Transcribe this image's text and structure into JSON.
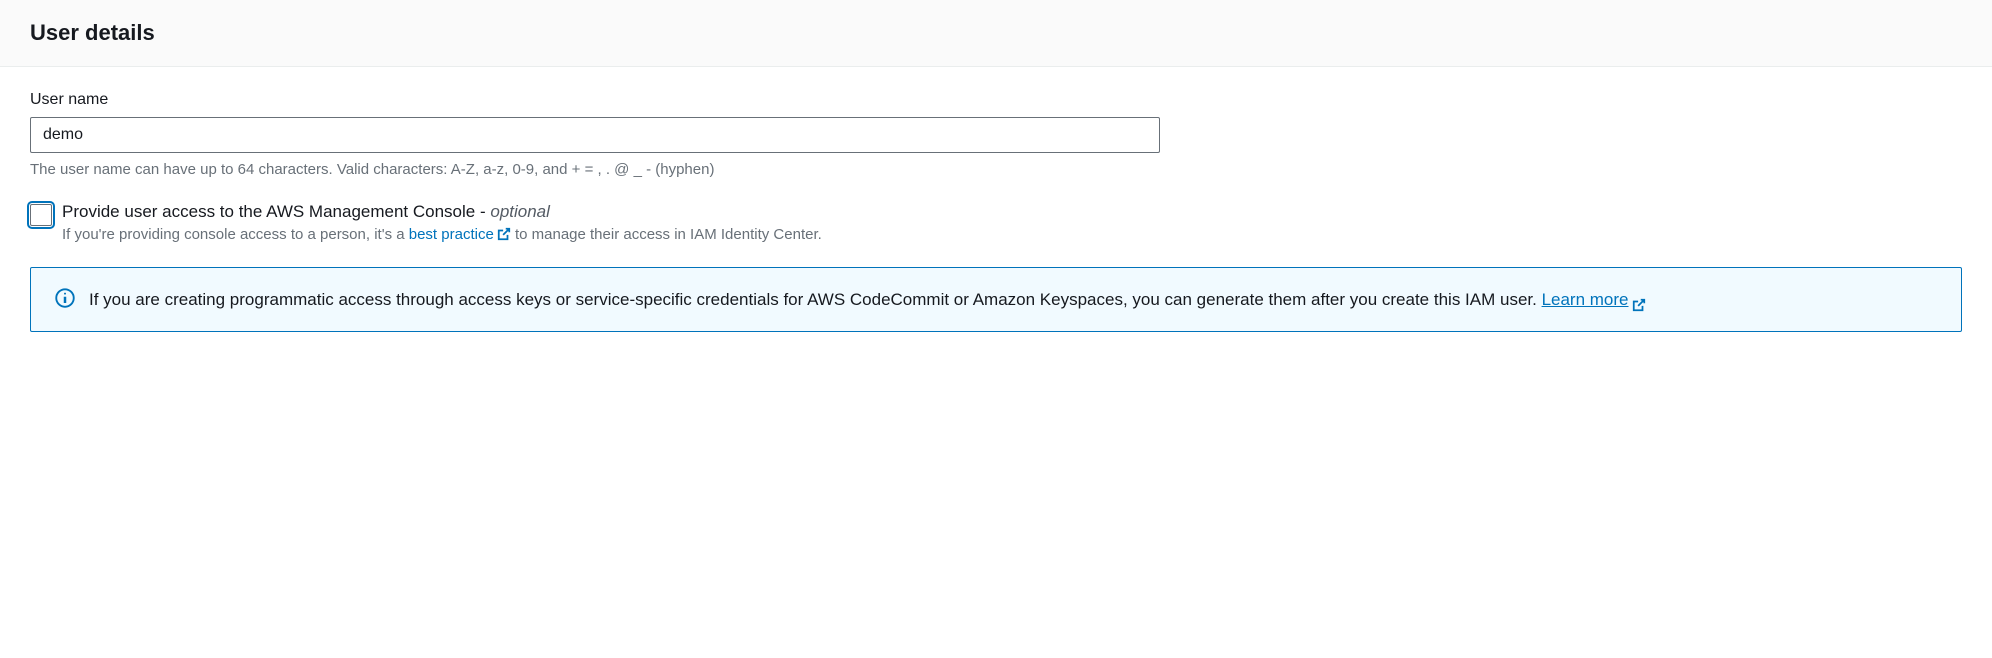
{
  "header": {
    "title": "User details"
  },
  "username": {
    "label": "User name",
    "value": "demo",
    "helper": "The user name can have up to 64 characters. Valid characters: A-Z, a-z, 0-9, and + = , . @ _ - (hyphen)"
  },
  "consoleAccess": {
    "label": "Provide user access to the AWS Management Console - ",
    "optional": "optional",
    "helperPrefix": "If you're providing console access to a person, it's a ",
    "bestPracticeLink": "best practice",
    "helperSuffix": " to manage their access in IAM Identity Center."
  },
  "infoBox": {
    "text": "If you are creating programmatic access through access keys or service-specific credentials for AWS CodeCommit or Amazon Keyspaces, you can generate them after you create this IAM user. ",
    "learnMore": "Learn more"
  }
}
